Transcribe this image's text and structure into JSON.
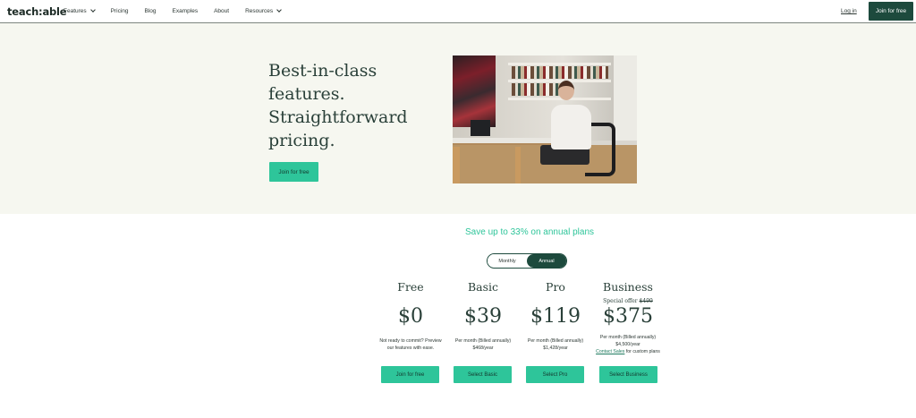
{
  "nav": {
    "logo": "teach:able",
    "links": [
      {
        "label": "Features",
        "dropdown": true
      },
      {
        "label": "Pricing",
        "dropdown": false
      },
      {
        "label": "Blog",
        "dropdown": false
      },
      {
        "label": "Examples",
        "dropdown": false
      },
      {
        "label": "About",
        "dropdown": false
      },
      {
        "label": "Resources",
        "dropdown": true
      }
    ],
    "login": "Log in",
    "cta": "Join for free"
  },
  "hero": {
    "title": "Best-in-class features. Straightforward pricing.",
    "cta": "Join for free"
  },
  "pricing": {
    "save_text": "Save up to 33% on annual plans",
    "toggle": {
      "monthly": "Monthly",
      "annual": "Annual",
      "selected": "Annual"
    },
    "plans": [
      {
        "name": "Free",
        "special_label": "",
        "old_price": "",
        "price": "$0",
        "desc_line1": "Not ready to commit? Preview",
        "desc_line2": "our features with ease.",
        "link": "",
        "link_suffix": "",
        "cta": "Join for free"
      },
      {
        "name": "Basic",
        "special_label": "",
        "old_price": "",
        "price": "$39",
        "desc_line1": "Per month (Billed annually)",
        "desc_line2": "$468/year",
        "link": "",
        "link_suffix": "",
        "cta": "Select Basic"
      },
      {
        "name": "Pro",
        "special_label": "",
        "old_price": "",
        "price": "$119",
        "desc_line1": "Per month (Billed annually)",
        "desc_line2": "$1,428/year",
        "link": "",
        "link_suffix": "",
        "cta": "Select Pro"
      },
      {
        "name": "Business",
        "special_label": "Special offer",
        "old_price": "$499",
        "price": "$375",
        "desc_line1": "Per month (Billed annually)",
        "desc_line2": "$4,500/year",
        "link": "Contact Sales",
        "link_suffix": " for custom plans",
        "cta": "Select Business"
      }
    ]
  },
  "colors": {
    "brand_dark": "#1d4a3d",
    "accent_green": "#2ec59a",
    "hero_bg": "#f6f7f0"
  }
}
